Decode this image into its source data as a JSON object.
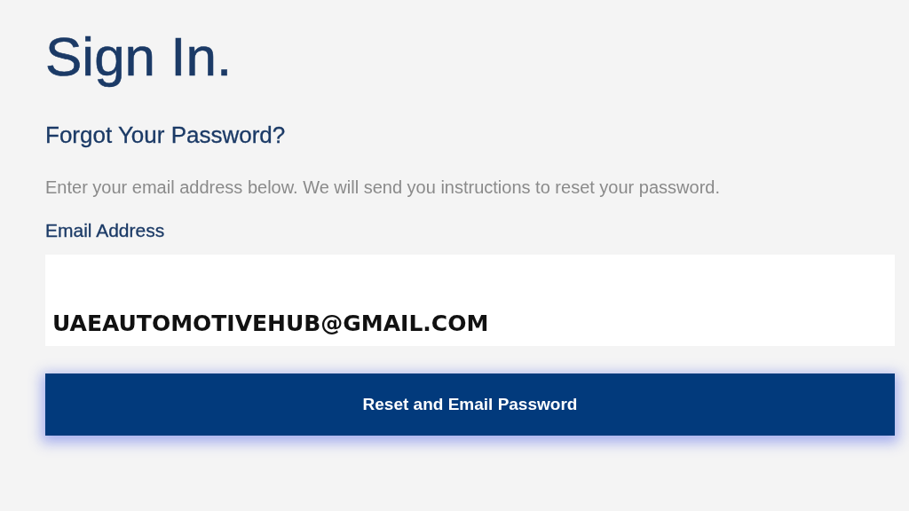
{
  "title": "Sign In.",
  "subtitle": "Forgot Your Password?",
  "instructions": "Enter your email address below. We will send you instructions to reset your password.",
  "email_field": {
    "label": "Email Address",
    "value": "UAEAUTOMOTIVEHUB@GMAIL.COM"
  },
  "buttons": [
    {
      "label": "Reset and Email Password"
    }
  ]
}
